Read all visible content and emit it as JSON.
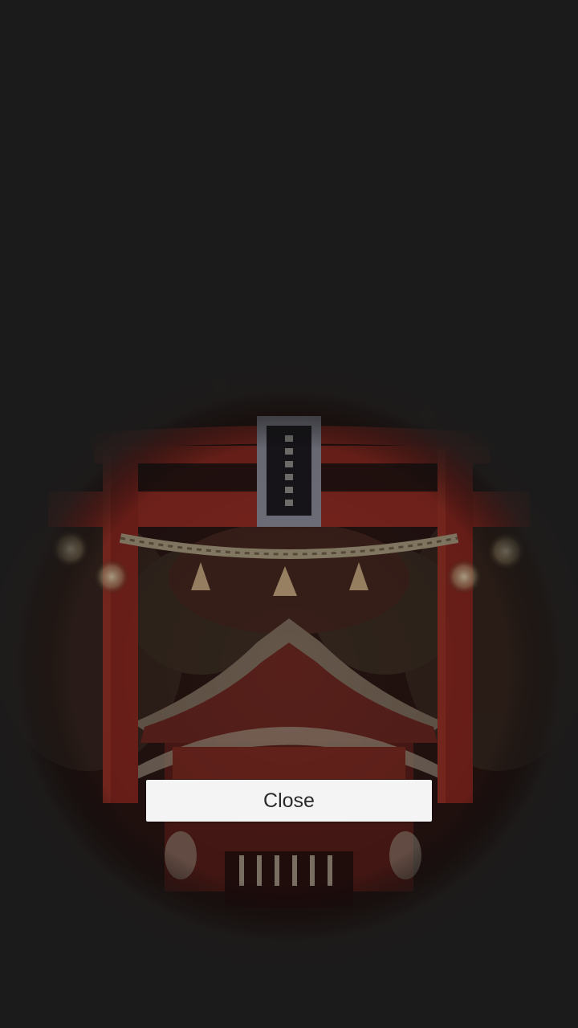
{
  "scene": {
    "icon": "shrine-torii-gate-image",
    "colors": {
      "background": "#1c1b1b",
      "torii_red": "#8a2a22",
      "lantern_glow": "#d8c7a0"
    }
  },
  "dialog": {
    "close_label": "Close"
  }
}
